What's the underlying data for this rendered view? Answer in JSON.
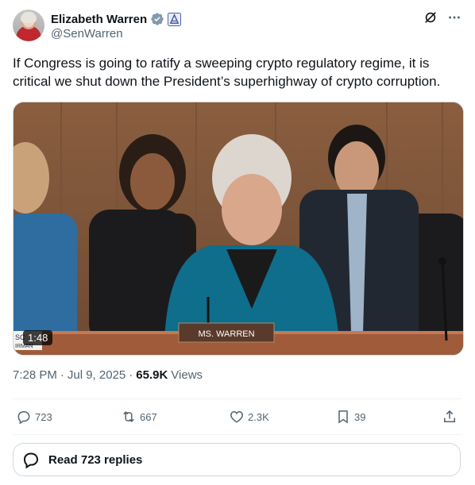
{
  "author": {
    "display_name": "Elizabeth Warren",
    "handle": "@SenWarren",
    "verified_color": "#829aab"
  },
  "tweet": {
    "text": "If Congress is going to ratify a sweeping crypto regulatory regime, it is critical we shut down the President’s superhighway of crypto corruption."
  },
  "media": {
    "duration": "1:48",
    "nameplate": "MS. WARREN",
    "left_placard": "SC\nIRMAN"
  },
  "meta": {
    "time": "7:28 PM",
    "date": "Jul 9, 2025",
    "views_count": "65.9K",
    "views_label": "Views",
    "sep1": "·",
    "sep2": "·"
  },
  "actions": {
    "replies": "723",
    "reposts": "667",
    "likes": "2.3K",
    "bookmarks": "39"
  },
  "read_replies": {
    "label": "Read 723 replies"
  },
  "colors": {
    "text_primary": "#0f1419",
    "text_secondary": "#536471",
    "border": "#cfd9de"
  }
}
